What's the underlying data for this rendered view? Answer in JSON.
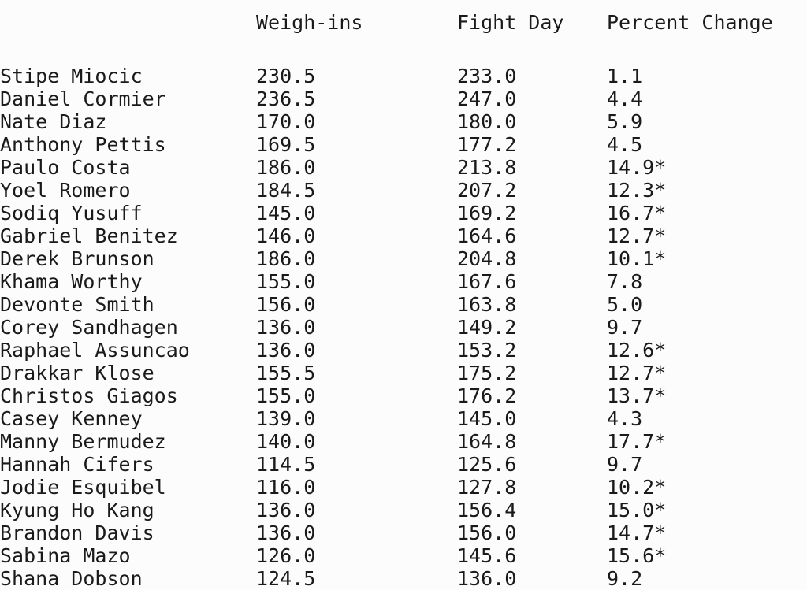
{
  "table": {
    "columns": [
      {
        "key": "name",
        "label": ""
      },
      {
        "key": "weigh_ins",
        "label": "Weigh-ins"
      },
      {
        "key": "fight_day",
        "label": "Fight Day"
      },
      {
        "key": "percent_change",
        "label": "Percent Change"
      }
    ],
    "rows": [
      {
        "name": "Stipe Miocic",
        "weigh_ins": "230.5",
        "fight_day": "233.0",
        "percent_change": "1.1"
      },
      {
        "name": "Daniel Cormier",
        "weigh_ins": "236.5",
        "fight_day": "247.0",
        "percent_change": "4.4"
      },
      {
        "name": "Nate Diaz",
        "weigh_ins": "170.0",
        "fight_day": "180.0",
        "percent_change": "5.9"
      },
      {
        "name": "Anthony Pettis",
        "weigh_ins": "169.5",
        "fight_day": "177.2",
        "percent_change": "4.5"
      },
      {
        "name": "Paulo Costa",
        "weigh_ins": "186.0",
        "fight_day": "213.8",
        "percent_change": "14.9*"
      },
      {
        "name": "Yoel Romero",
        "weigh_ins": "184.5",
        "fight_day": "207.2",
        "percent_change": "12.3*"
      },
      {
        "name": "Sodiq Yusuff",
        "weigh_ins": "145.0",
        "fight_day": "169.2",
        "percent_change": "16.7*"
      },
      {
        "name": "Gabriel Benitez",
        "weigh_ins": "146.0",
        "fight_day": "164.6",
        "percent_change": "12.7*"
      },
      {
        "name": "Derek Brunson",
        "weigh_ins": "186.0",
        "fight_day": "204.8",
        "percent_change": "10.1*"
      },
      {
        "name": "Khama Worthy",
        "weigh_ins": "155.0",
        "fight_day": "167.6",
        "percent_change": "7.8"
      },
      {
        "name": "Devonte Smith",
        "weigh_ins": "156.0",
        "fight_day": "163.8",
        "percent_change": "5.0"
      },
      {
        "name": "Corey Sandhagen",
        "weigh_ins": "136.0",
        "fight_day": "149.2",
        "percent_change": "9.7"
      },
      {
        "name": "Raphael Assuncao",
        "weigh_ins": "136.0",
        "fight_day": "153.2",
        "percent_change": "12.6*"
      },
      {
        "name": "Drakkar Klose",
        "weigh_ins": "155.5",
        "fight_day": "175.2",
        "percent_change": "12.7*"
      },
      {
        "name": "Christos Giagos",
        "weigh_ins": "155.0",
        "fight_day": "176.2",
        "percent_change": "13.7*"
      },
      {
        "name": "Casey Kenney",
        "weigh_ins": "139.0",
        "fight_day": "145.0",
        "percent_change": "4.3"
      },
      {
        "name": "Manny Bermudez",
        "weigh_ins": "140.0",
        "fight_day": "164.8",
        "percent_change": "17.7*"
      },
      {
        "name": "Hannah Cifers",
        "weigh_ins": "114.5",
        "fight_day": "125.6",
        "percent_change": "9.7"
      },
      {
        "name": "Jodie Esquibel",
        "weigh_ins": "116.0",
        "fight_day": "127.8",
        "percent_change": "10.2*"
      },
      {
        "name": "Kyung Ho Kang",
        "weigh_ins": "136.0",
        "fight_day": "156.4",
        "percent_change": "15.0*"
      },
      {
        "name": "Brandon Davis",
        "weigh_ins": "136.0",
        "fight_day": "156.0",
        "percent_change": "14.7*"
      },
      {
        "name": "Sabina Mazo",
        "weigh_ins": "126.0",
        "fight_day": "145.6",
        "percent_change": "15.6*"
      },
      {
        "name": "Shana Dobson",
        "weigh_ins": "124.5",
        "fight_day": "136.0",
        "percent_change": "9.2"
      }
    ]
  },
  "colors": {
    "background": "#fcfcfc",
    "text": "#1a1a1a"
  }
}
